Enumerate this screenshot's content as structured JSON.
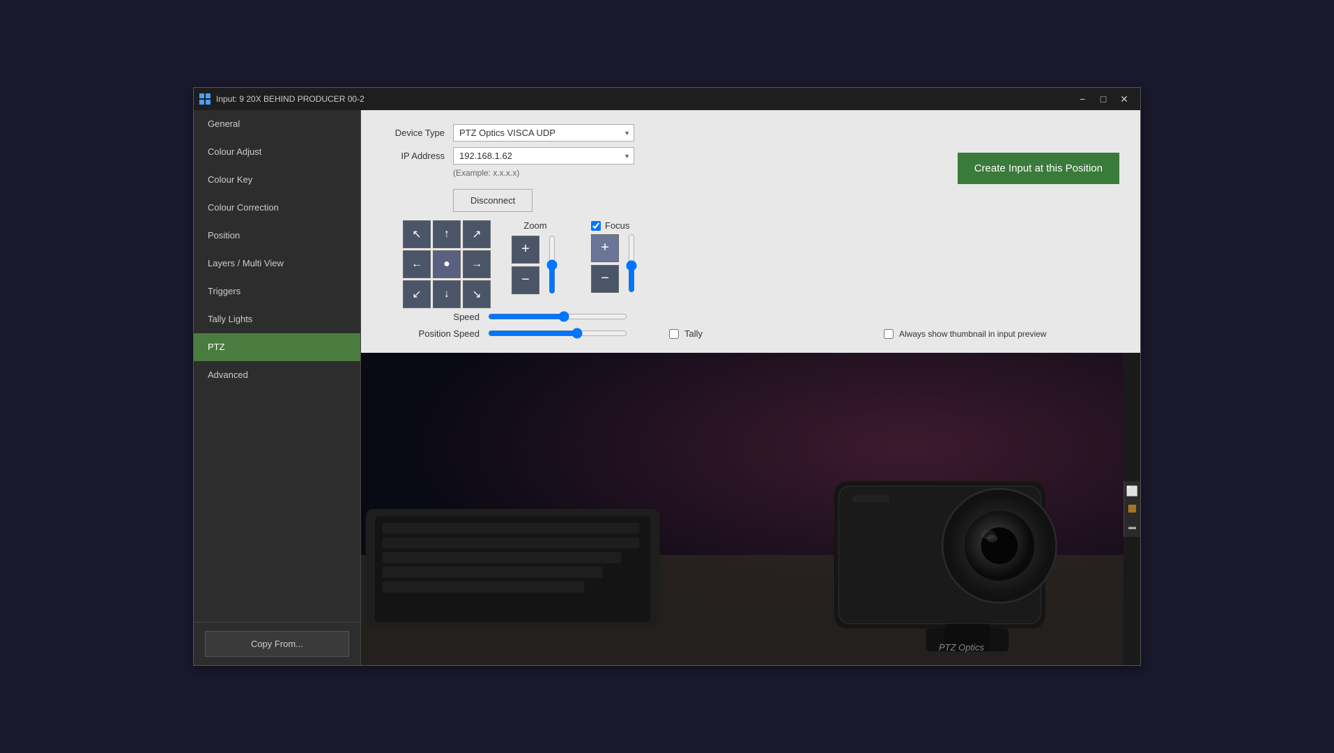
{
  "window": {
    "title": "Input: 9 20X BEHIND PRODUCER 00-2",
    "minimize_label": "−",
    "maximize_label": "□",
    "close_label": "✕"
  },
  "sidebar": {
    "items": [
      {
        "id": "general",
        "label": "General",
        "active": false
      },
      {
        "id": "colour-adjust",
        "label": "Colour Adjust",
        "active": false
      },
      {
        "id": "colour-key",
        "label": "Colour Key",
        "active": false
      },
      {
        "id": "colour-correction",
        "label": "Colour Correction",
        "active": false
      },
      {
        "id": "position",
        "label": "Position",
        "active": false
      },
      {
        "id": "layers-multi-view",
        "label": "Layers / Multi View",
        "active": false
      },
      {
        "id": "triggers",
        "label": "Triggers",
        "active": false
      },
      {
        "id": "tally-lights",
        "label": "Tally Lights",
        "active": false
      },
      {
        "id": "ptz",
        "label": "PTZ",
        "active": true
      },
      {
        "id": "advanced",
        "label": "Advanced",
        "active": false
      }
    ],
    "copy_from_label": "Copy From..."
  },
  "main": {
    "device_type_label": "Device Type",
    "ip_address_label": "IP Address",
    "device_type_value": "PTZ Optics VISCA UDP",
    "ip_address_value": "192.168.1.62",
    "ip_example": "(Example: x.x.x.x)",
    "disconnect_label": "Disconnect",
    "create_input_label": "Create Input at this Position",
    "zoom_label": "Zoom",
    "focus_label": "Focus",
    "focus_checked": true,
    "tally_label": "Tally",
    "tally_checked": false,
    "speed_label": "Speed",
    "position_speed_label": "Position Speed",
    "always_show_thumbnail_label": "Always show thumbnail in input preview",
    "always_show_thumbnail_checked": false,
    "ptz_optics_watermark": "PTZ Optics",
    "dpad_buttons": [
      {
        "id": "upleft",
        "icon": "↖",
        "title": "Up Left"
      },
      {
        "id": "up",
        "icon": "↑",
        "title": "Up"
      },
      {
        "id": "upright",
        "icon": "↗",
        "title": "Up Right"
      },
      {
        "id": "left",
        "icon": "←",
        "title": "Left"
      },
      {
        "id": "center",
        "icon": "●",
        "title": "Center"
      },
      {
        "id": "right",
        "icon": "→",
        "title": "Right"
      },
      {
        "id": "downleft",
        "icon": "↙",
        "title": "Down Left"
      },
      {
        "id": "down",
        "icon": "↓",
        "title": "Down"
      },
      {
        "id": "downright",
        "icon": "↘",
        "title": "Down Right"
      }
    ],
    "zoom_plus": "+",
    "zoom_minus": "−",
    "focus_plus": "+",
    "focus_minus": "−",
    "speed_value": 55,
    "position_speed_value": 65
  },
  "right_sidebar": {
    "icons": [
      {
        "id": "layout-icon",
        "symbol": "⬜"
      },
      {
        "id": "color-icon",
        "symbol": "🔲"
      },
      {
        "id": "bottom-icon",
        "symbol": "▬"
      }
    ]
  }
}
